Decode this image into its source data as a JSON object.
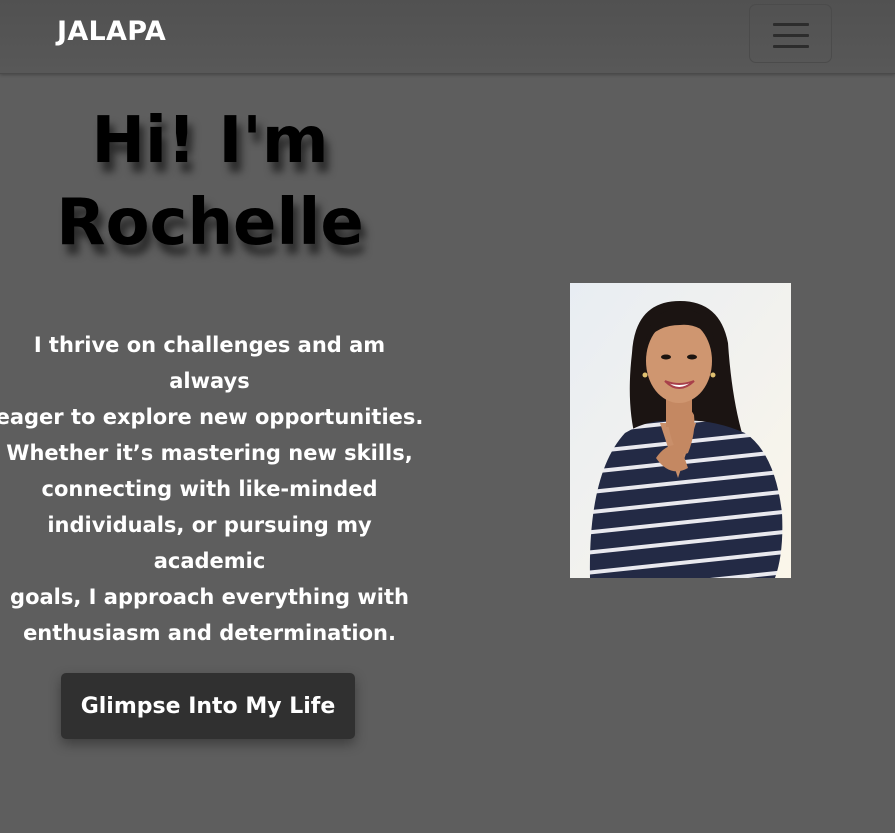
{
  "navbar": {
    "brand": "JALAPA",
    "toggle_icon": "hamburger-menu-icon"
  },
  "hero": {
    "title_line1": "Hi! I'm",
    "title_line2": "Rochelle",
    "paragraph_lines": [
      "I thrive on challenges and am always",
      "eager to explore new opportunities.",
      "Whether it’s mastering new skills,",
      "connecting with like-minded",
      "individuals, or pursuing my academic",
      "goals, I approach everything with",
      "enthusiasm and determination."
    ],
    "cta_label": "Glimpse Into My Life"
  },
  "colors": {
    "page_bg": "#5e5e5e",
    "navbar_bg": "#555555",
    "button_bg": "#303030",
    "text_light": "#ffffff",
    "title_text": "#000000"
  }
}
